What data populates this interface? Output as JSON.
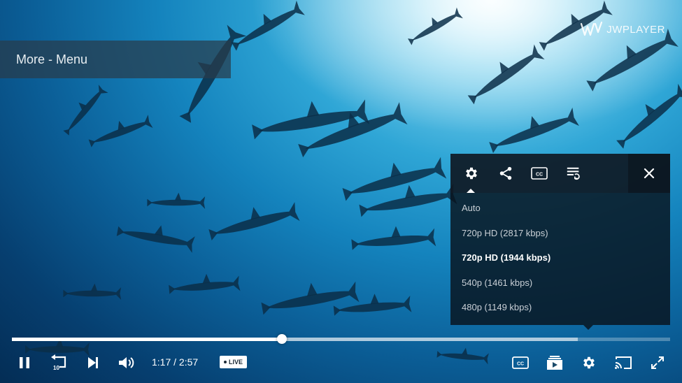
{
  "brand": {
    "logo_text": "JWPLAYER"
  },
  "more_menu": {
    "label": "More - Menu"
  },
  "settings_menu": {
    "tabs": [
      {
        "name": "settings",
        "icon": "gear-icon",
        "active": true
      },
      {
        "name": "share",
        "icon": "share-icon"
      },
      {
        "name": "captions",
        "icon": "cc-icon"
      },
      {
        "name": "playlist",
        "icon": "playlist-icon"
      }
    ],
    "close_icon": "close-icon",
    "quality_options": [
      {
        "label": "Auto"
      },
      {
        "label": "720p HD (2817 kbps)"
      },
      {
        "label": "720p HD (1944 kbps)",
        "selected": true
      },
      {
        "label": "540p (1461 kbps)"
      },
      {
        "label": "480p (1149 kbps)"
      }
    ]
  },
  "playback": {
    "time_display": "1:17 / 2:57",
    "progress_fraction": 0.41,
    "buffered_fraction": 0.86,
    "live_label": "LIVE"
  },
  "controls": {
    "left": [
      "pause-icon",
      "rewind-10-icon",
      "next-icon",
      "volume-icon"
    ],
    "right": [
      "cc-icon",
      "playlist-icon",
      "gear-icon",
      "cast-icon",
      "fullscreen-icon"
    ]
  },
  "colors": {
    "accent": "#ffffff",
    "menu_bg": "#08121c",
    "live_badge_bg": "#ffffff"
  }
}
